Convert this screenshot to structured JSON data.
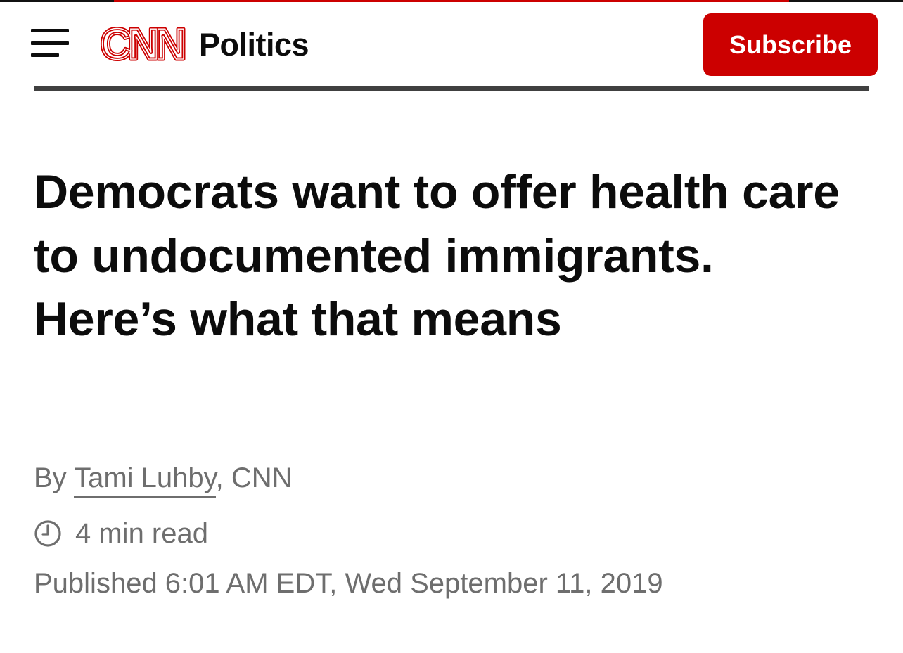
{
  "header": {
    "menu_icon": "hamburger-menu-icon",
    "logo_text": "CNN",
    "section": "Politics",
    "subscribe_label": "Subscribe"
  },
  "colors": {
    "brand_red": "#cc0000",
    "text": "#0c0c0c",
    "meta_gray": "#6e6e6e"
  },
  "article": {
    "headline": "Democrats want to offer health care to undocumented immigrants. Here’s what that means",
    "byline_prefix": "By ",
    "author": "Tami Luhby",
    "byline_suffix": ", CNN",
    "read_time_icon": "clock-icon",
    "read_time": "4 min read",
    "published": "Published 6:01 AM EDT, Wed September 11, 2019"
  }
}
